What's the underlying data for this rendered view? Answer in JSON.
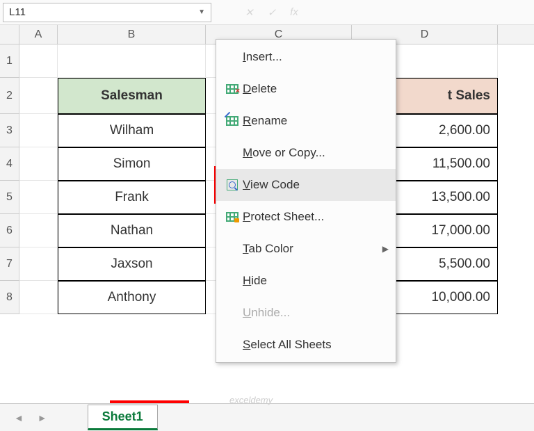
{
  "name_box": "L11",
  "fx_label": "fx",
  "columns": {
    "A": 55,
    "B": 213,
    "C": 210,
    "D": 210
  },
  "headers": {
    "B": "Salesman",
    "D": "t Sales"
  },
  "rows": [
    {
      "num": "1"
    },
    {
      "num": "2"
    },
    {
      "num": "3",
      "B": "Wilham",
      "D": "2,600.00"
    },
    {
      "num": "4",
      "B": "Simon",
      "D": "11,500.00"
    },
    {
      "num": "5",
      "B": "Frank",
      "D": "13,500.00"
    },
    {
      "num": "6",
      "B": "Nathan",
      "D": "17,000.00"
    },
    {
      "num": "7",
      "B": "Jaxson",
      "D": "5,500.00"
    },
    {
      "num": "8",
      "B": "Anthony",
      "D": "10,000.00"
    }
  ],
  "context_menu": {
    "insert": "Insert...",
    "delete": "Delete",
    "rename": "Rename",
    "move_copy": "Move or Copy...",
    "view_code": "View Code",
    "protect": "Protect Sheet...",
    "tab_color": "Tab Color",
    "hide": "Hide",
    "unhide": "Unhide...",
    "select_all": "Select All Sheets"
  },
  "sheet_tab": "Sheet1",
  "watermark": "exceldemy"
}
